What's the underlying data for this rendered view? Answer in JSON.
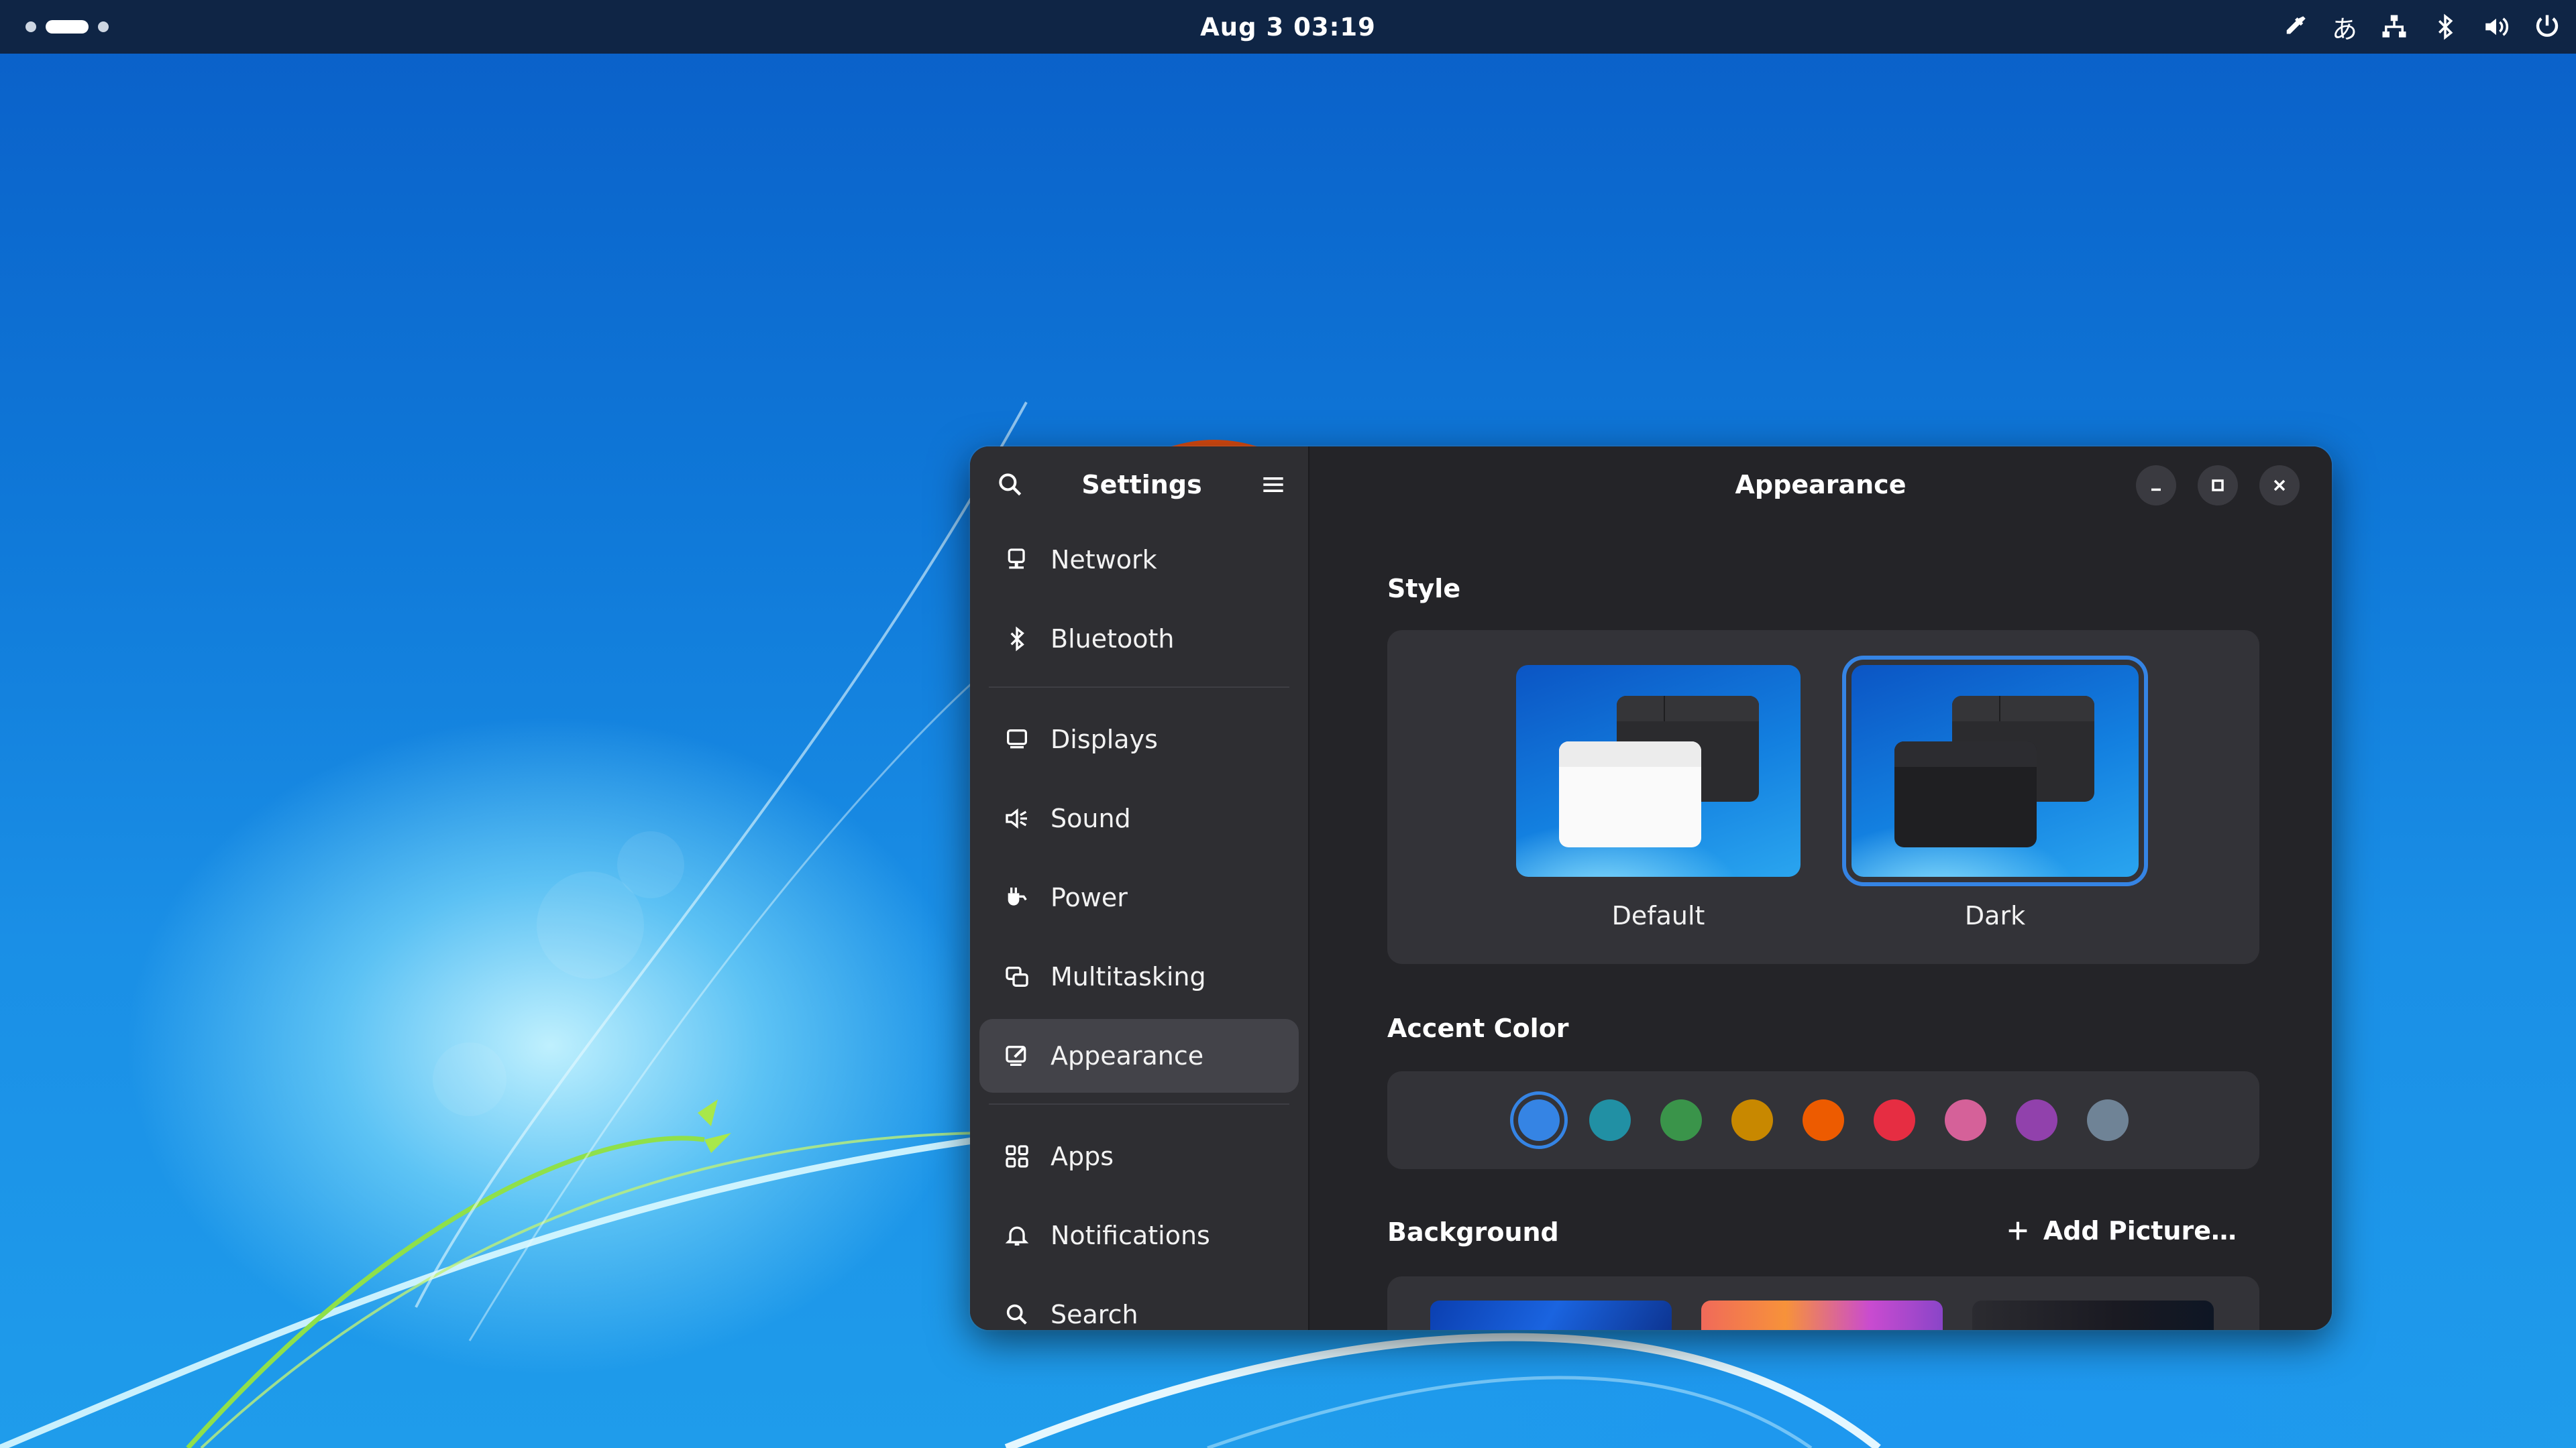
{
  "topbar": {
    "clock": "Aug 3  03:19",
    "tray": [
      "color-picker-icon",
      "input-method",
      "network-wired-icon",
      "bluetooth-icon",
      "volume-icon",
      "power-icon"
    ],
    "input_method": "あ"
  },
  "window": {
    "sidebar": {
      "title": "Settings",
      "items": [
        {
          "label": "Network",
          "icon": "network-icon"
        },
        {
          "label": "Bluetooth",
          "icon": "bluetooth-icon"
        },
        {
          "label": "Displays",
          "icon": "display-icon"
        },
        {
          "label": "Sound",
          "icon": "sound-icon"
        },
        {
          "label": "Power",
          "icon": "power-plug-icon"
        },
        {
          "label": "Multitasking",
          "icon": "multitasking-icon"
        },
        {
          "label": "Appearance",
          "icon": "appearance-icon",
          "active": true
        },
        {
          "label": "Apps",
          "icon": "apps-grid-icon"
        },
        {
          "label": "Notifications",
          "icon": "bell-icon"
        },
        {
          "label": "Search",
          "icon": "search-icon"
        }
      ]
    },
    "title": "Appearance",
    "style": {
      "heading": "Style",
      "options": [
        {
          "label": "Default",
          "selected": false
        },
        {
          "label": "Dark",
          "selected": true
        }
      ]
    },
    "accent": {
      "heading": "Accent Color",
      "colors": [
        "#3584e4",
        "#2190a4",
        "#3a944a",
        "#c88800",
        "#ed5b00",
        "#e62d42",
        "#d56199",
        "#9141ac",
        "#6f8396"
      ],
      "selected_index": 0
    },
    "background": {
      "heading": "Background",
      "add_label": "Add Picture…"
    }
  }
}
